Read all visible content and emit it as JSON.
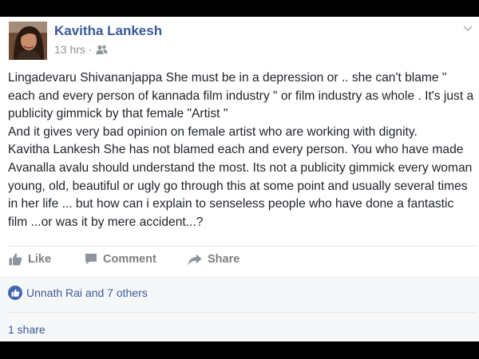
{
  "post": {
    "author": "Kavitha Lankesh",
    "time": "13 hrs",
    "separator": "·",
    "audience_icon": "friends-icon",
    "paragraphs": [
      "Lingadevaru Shivananjappa She must be in a depression or .. she can't blame \" each and every person of kannada film industry \" or film industry as whole . It's just a publicity gimmick by that female \"Artist \"",
      "And it gives very bad opinion on female artist who are working with dignity.",
      "Kavitha Lankesh She has not blamed each and every person. You who have made Avanalla avalu should understand the most. Its not a publicity gimmick every woman young, old, beautiful or ugly go through this at some point and usually several times in her life ... but how can i explain to senseless people who have done a fantastic film ...or was it by mere accident...?"
    ]
  },
  "actions": {
    "like": "Like",
    "comment": "Comment",
    "share": "Share"
  },
  "footer": {
    "likes_text": "Unnath Rai and 7 others",
    "shares_text": "1 share"
  },
  "colors": {
    "link": "#3b5998",
    "action_gray": "#7f7f7f",
    "like_badge": "#4267b2"
  }
}
